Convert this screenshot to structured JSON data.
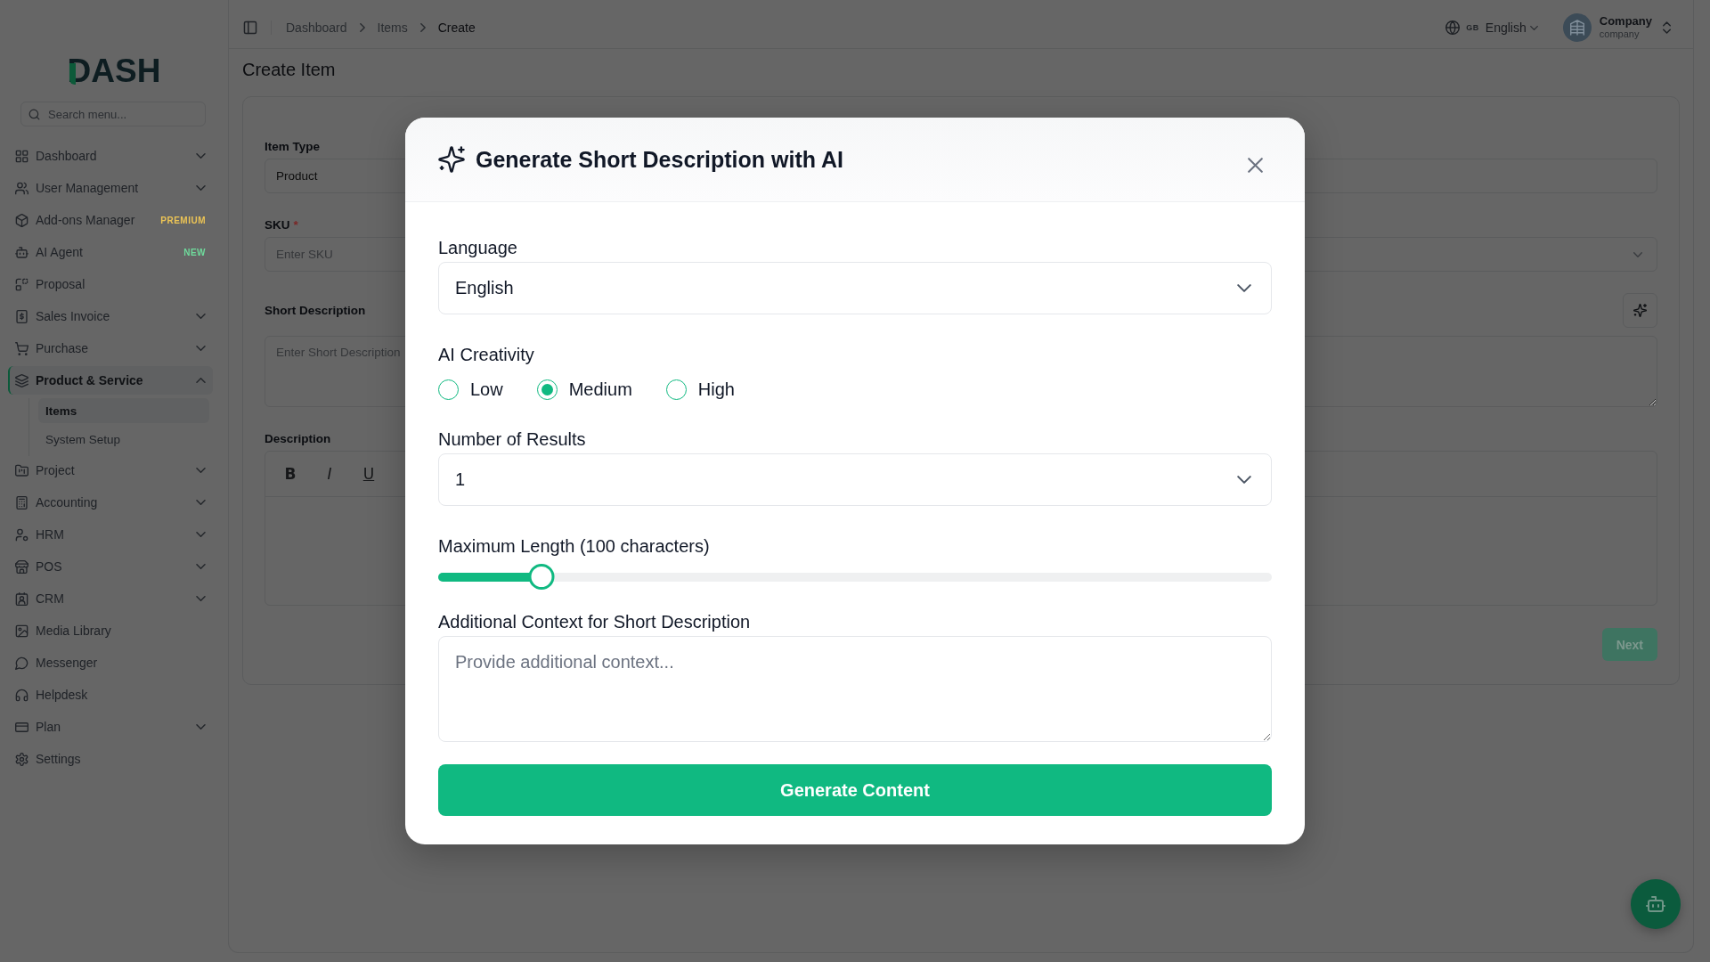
{
  "sidebar": {
    "logo": "DASH",
    "search": {
      "placeholder": "Search menu..."
    },
    "items": [
      {
        "kind": "group",
        "label": "Dashboard",
        "expanded": false,
        "selected": false
      },
      {
        "kind": "group",
        "label": "User Management",
        "expanded": false,
        "selected": false
      },
      {
        "kind": "link",
        "label": "Add-ons Manager",
        "selected": false,
        "badge": {
          "text": "PREMIUM",
          "color": "#ecc455"
        }
      },
      {
        "kind": "link",
        "label": "AI Agent",
        "selected": false,
        "badge": {
          "text": "NEW",
          "color": "#6fdb9c"
        }
      },
      {
        "kind": "link",
        "label": "Proposal",
        "selected": false
      },
      {
        "kind": "group",
        "label": "Sales Invoice",
        "expanded": false,
        "selected": false
      },
      {
        "kind": "group",
        "label": "Purchase",
        "expanded": false,
        "selected": false
      },
      {
        "kind": "group",
        "label": "Product & Service",
        "expanded": true,
        "selected": true,
        "children": [
          {
            "label": "Items",
            "selected": true
          },
          {
            "label": "System Setup",
            "selected": false
          }
        ]
      },
      {
        "kind": "group",
        "label": "Project",
        "expanded": false,
        "selected": false
      },
      {
        "kind": "group",
        "label": "Accounting",
        "expanded": false,
        "selected": false
      },
      {
        "kind": "group",
        "label": "HRM",
        "expanded": false,
        "selected": false
      },
      {
        "kind": "group",
        "label": "POS",
        "expanded": false,
        "selected": false
      },
      {
        "kind": "group",
        "label": "CRM",
        "expanded": false,
        "selected": false
      },
      {
        "kind": "link",
        "label": "Media Library",
        "selected": false
      },
      {
        "kind": "link",
        "label": "Messenger",
        "selected": false
      },
      {
        "kind": "link",
        "label": "Helpdesk",
        "selected": false
      },
      {
        "kind": "group",
        "label": "Plan",
        "expanded": false,
        "selected": false
      },
      {
        "kind": "link",
        "label": "Settings",
        "selected": false
      }
    ]
  },
  "topbar": {
    "breadcrumbs": [
      {
        "label": "Dashboard",
        "current": false
      },
      {
        "label": "Items",
        "current": false
      },
      {
        "label": "Create",
        "current": true
      }
    ],
    "language": {
      "code": "GB",
      "label": "English"
    },
    "account": {
      "name": "Company",
      "role": "company"
    }
  },
  "page": {
    "title": "Create Item",
    "form": {
      "rows": [
        {
          "fields": [
            {
              "kind": "input",
              "label": "Item Type",
              "value": "Product"
            },
            {
              "kind": "input"
            }
          ]
        },
        {
          "fields": [
            {
              "kind": "input",
              "label": "SKU",
              "required_mark": "*",
              "placeholder": "Enter SKU"
            },
            {
              "kind": "select"
            }
          ]
        }
      ],
      "short_description": {
        "label": "Short Description",
        "placeholder": "Enter Short Description"
      },
      "description": {
        "label": "Description",
        "toolbar": [
          {
            "kind": "bold",
            "glyph": "B"
          },
          {
            "kind": "italic",
            "glyph": "I"
          },
          {
            "kind": "underline",
            "glyph": "U"
          }
        ]
      },
      "next_button": {
        "label": "Next",
        "disabled": true
      }
    }
  },
  "dialog": {
    "title": "Generate Short Description with AI",
    "language": {
      "label": "Language",
      "value": "English"
    },
    "creativity": {
      "label": "AI Creativity",
      "options": [
        {
          "label": "Low",
          "selected": false
        },
        {
          "label": "Medium",
          "selected": true
        },
        {
          "label": "High",
          "selected": false
        }
      ]
    },
    "results": {
      "label": "Number of Results",
      "value": "1"
    },
    "max_length": {
      "label": "Maximum Length (100 characters)",
      "level": 0.124
    },
    "context": {
      "label": "Additional Context for Short Description",
      "placeholder": "Provide additional context..."
    },
    "submit": {
      "label": "Generate Content"
    }
  }
}
